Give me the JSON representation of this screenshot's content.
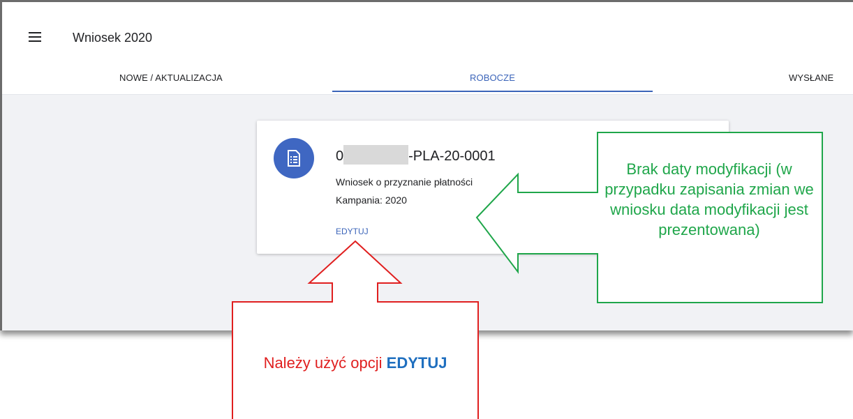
{
  "app": {
    "title": "Wniosek 2020",
    "tabs": [
      {
        "label": "NOWE / AKTUALIZACJA",
        "active": false
      },
      {
        "label": "ROBOCZE",
        "active": true
      },
      {
        "label": "WYSŁANE",
        "active": false
      }
    ]
  },
  "card": {
    "id_prefix": "0",
    "id_suffix": "-PLA-20-0001",
    "type": "Wniosek o przyznanie płatności",
    "campaign": "Kampania: 2020",
    "edit_label": "EDYTUJ",
    "icon": "document-list-icon"
  },
  "annotations": {
    "green_callout": "Brak daty modyfikacji (w przypadku zapisania zmian we wniosku data modyfikacji jest prezentowana)",
    "red_callout_prefix": "Należy użyć opcji ",
    "red_callout_emphasis": "EDYTUJ"
  },
  "colors": {
    "accent": "#3b64b9",
    "avatar": "#3f67c2",
    "green_callout": "#1fa64a",
    "red_callout": "#e01f1f",
    "emphasis_blue": "#1f6fbf"
  }
}
